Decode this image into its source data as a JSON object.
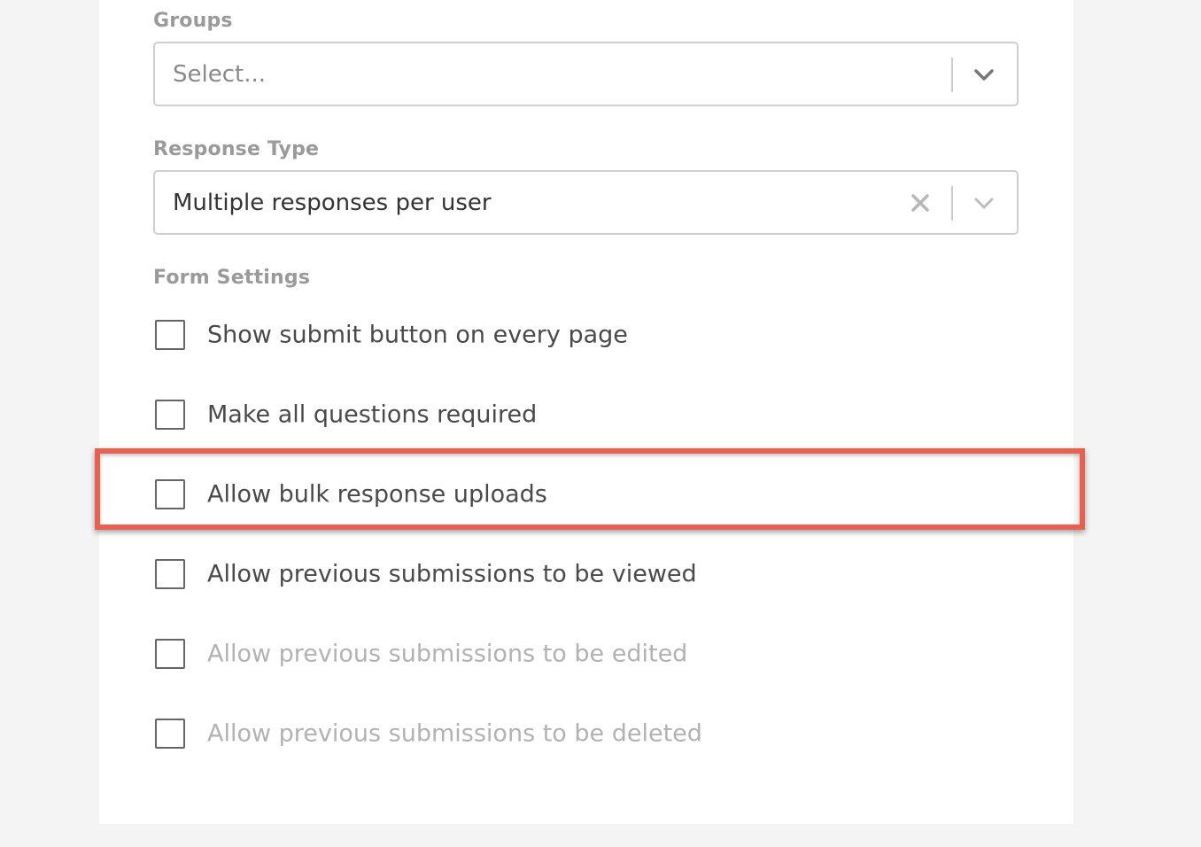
{
  "groups": {
    "label": "Groups",
    "placeholder": "Select..."
  },
  "response_type": {
    "label": "Response Type",
    "value": "Multiple responses per user"
  },
  "form_settings": {
    "label": "Form Settings",
    "options": [
      {
        "label": "Show submit button on every page",
        "checked": false,
        "disabled": false
      },
      {
        "label": "Make all questions required",
        "checked": false,
        "disabled": false
      },
      {
        "label": "Allow bulk response uploads",
        "checked": false,
        "disabled": false,
        "highlighted": true
      },
      {
        "label": "Allow previous submissions to be viewed",
        "checked": false,
        "disabled": false
      },
      {
        "label": "Allow previous submissions to be edited",
        "checked": false,
        "disabled": true
      },
      {
        "label": "Allow previous submissions to be deleted",
        "checked": false,
        "disabled": true
      }
    ]
  },
  "icons": {
    "chevron": "chevron-down-icon",
    "clear": "close-icon"
  },
  "colors": {
    "highlight": "#e8604f",
    "label_gray": "#9a9a9a",
    "disabled_text": "#b2b2b2",
    "text": "#4a4a4a"
  }
}
